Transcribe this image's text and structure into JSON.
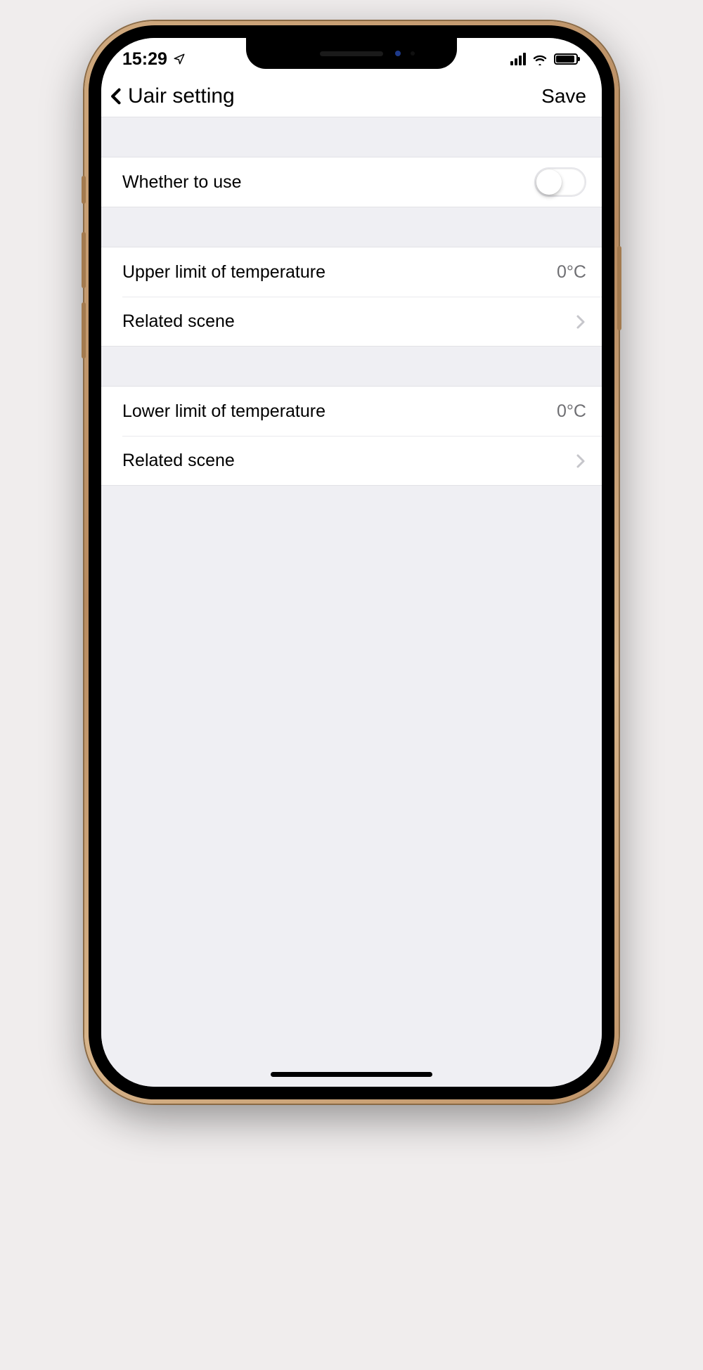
{
  "status": {
    "time": "15:29"
  },
  "header": {
    "title": "Uair setting",
    "save": "Save"
  },
  "rows": {
    "whether": {
      "label": "Whether to use",
      "toggle": false
    },
    "upper": {
      "label": "Upper limit of temperature",
      "value": "0°C"
    },
    "upper_scene": {
      "label": "Related scene"
    },
    "lower": {
      "label": "Lower limit of temperature",
      "value": "0°C"
    },
    "lower_scene": {
      "label": "Related scene"
    }
  }
}
